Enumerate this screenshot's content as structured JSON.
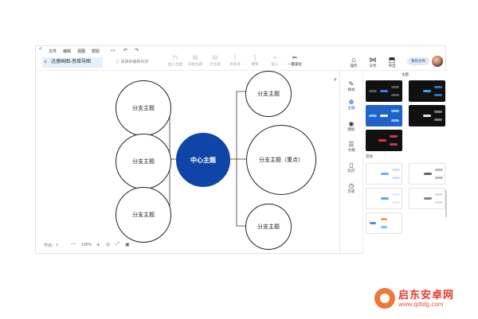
{
  "menu": {
    "items": [
      "文件",
      "编辑",
      "视图",
      "帮助"
    ],
    "icons": [
      "save-icon",
      "undo-icon",
      "redo-icon"
    ]
  },
  "doc": {
    "back": "<",
    "title": "迅捷画图-思维导图"
  },
  "search": {
    "placeholder": "请保存编辑内容"
  },
  "toolbar": {
    "items": [
      {
        "label": "插入主题",
        "icon": "insert-topic-icon"
      },
      {
        "label": "同级主题",
        "icon": "sibling-topic-icon"
      },
      {
        "label": "子主题",
        "icon": "child-topic-icon"
      },
      {
        "label": "关系线",
        "icon": "relation-line-icon"
      },
      {
        "label": "概要",
        "icon": "summary-icon"
      },
      {
        "label": "插入",
        "icon": "insert-icon"
      },
      {
        "label": "一键美化",
        "icon": "beautify-icon"
      }
    ]
  },
  "right_toolbar": {
    "items": [
      {
        "label": "操作",
        "icon": "operation-icon"
      },
      {
        "label": "分享",
        "icon": "share-icon"
      },
      {
        "label": "导出",
        "icon": "export-icon"
      }
    ],
    "share_label": "我的文件"
  },
  "mindmap": {
    "center": "中心主题",
    "left": [
      "分支主题",
      "分支主题",
      "分支主题"
    ],
    "right": [
      "分支主题",
      "分支主题（重点）",
      "分支主题"
    ]
  },
  "zoom": {
    "nodes_label": "节点：7",
    "zoom_level": "100%",
    "minus": "—",
    "plus": "+"
  },
  "side_tools": [
    {
      "label": "样式",
      "icon": "style-icon",
      "active": false
    },
    {
      "label": "主题",
      "icon": "theme-icon",
      "active": true
    },
    {
      "label": "图标",
      "icon": "icon-library-icon",
      "active": false
    },
    {
      "label": "大纲",
      "icon": "outline-icon",
      "active": false
    },
    {
      "label": "幻灯",
      "icon": "slides-icon",
      "active": false
    },
    {
      "label": "历史",
      "icon": "history-icon",
      "active": false
    }
  ],
  "theme_panel": {
    "section1": "主题",
    "section2": "其他"
  },
  "watermark": {
    "title": "启东安卓网",
    "url": "www.qdtdg.com"
  },
  "colors": {
    "accent": "#0f45a8",
    "active_tool": "#1e5fcf",
    "watermark": "#e23a2a"
  }
}
